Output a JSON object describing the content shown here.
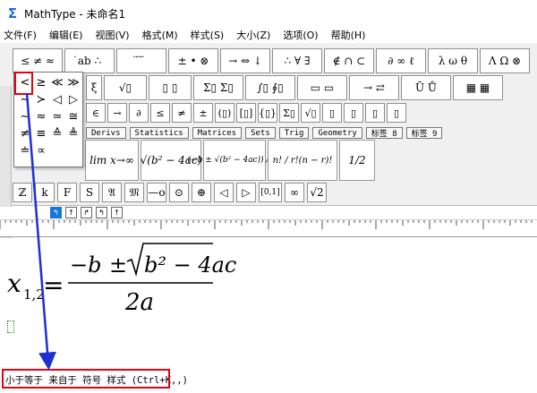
{
  "window": {
    "title": "MathType - 未命名1",
    "icon": "sigma-icon"
  },
  "menu": [
    "文件(F)",
    "编辑(E)",
    "视图(V)",
    "格式(M)",
    "样式(S)",
    "大小(Z)",
    "选项(O)",
    "帮助(H)"
  ],
  "toolbar": {
    "row1": [
      "≤ ≠ ≈",
      "̇ab ∴",
      "̈ ̈ ̈",
      "± • ⊗",
      "→ ⇔ ↓",
      "∴ ∀ ∃",
      "∉ ∩ ⊂",
      "∂ ∞ ℓ",
      "λ ω θ",
      "Λ Ω ⊗"
    ],
    "row2": [
      "ξ",
      "√▯",
      "▯ ▯",
      "Σ▯ Σ▯",
      "∫▯ ∮▯",
      "▭ ▭",
      "→ ⇄",
      "Ū Ů",
      "▦ ▦"
    ],
    "row3": [
      "∈",
      "→",
      "∂",
      "≤",
      "≠",
      "±",
      "(▯)",
      "[▯]",
      "{▯}",
      "Σ▯",
      "√▯",
      "▯",
      "▯",
      "▯",
      "▯"
    ]
  },
  "popup": {
    "symbols": [
      "<",
      "≥",
      "≪",
      "≫",
      "∼",
      "≻",
      "◁",
      "▷",
      "∼",
      "≈",
      "≃",
      "≅",
      "≠",
      "≡",
      "≙",
      "≜",
      "≐",
      "∝"
    ]
  },
  "tabs": [
    "Derivs",
    "Statistics",
    "Matrices",
    "Sets",
    "Trig",
    "Geometry",
    "标签 8",
    "标签 9"
  ],
  "templates": [
    "lim x→∞",
    "√(b² − 4ac)",
    "(−b ± √(b² − 4ac)) / 2a",
    "n! / r!(n − r)!",
    "1/2"
  ],
  "palette": [
    "ℤ",
    "k",
    "F",
    "S",
    "𝔄",
    "𝔐",
    "—o",
    "⊙",
    "⊕",
    "◁",
    "▷",
    "[0,1]",
    "∞",
    "√2"
  ],
  "ruler_buttons": [
    "↰",
    "↑",
    "↱",
    "↰",
    "↑"
  ],
  "equation": {
    "lhs": "x",
    "subscript": "1,2",
    "equals": "=",
    "minus_b": "−b",
    "pm": "±",
    "radicand": "b² − 4ac",
    "denominator": "2a"
  },
  "status": {
    "text": "小于等于 来自于 符号 样式 (Ctrl+K,,)"
  },
  "annotation": {
    "highlight_color": "#e60012",
    "arrow_color": "#1e2fd6"
  }
}
